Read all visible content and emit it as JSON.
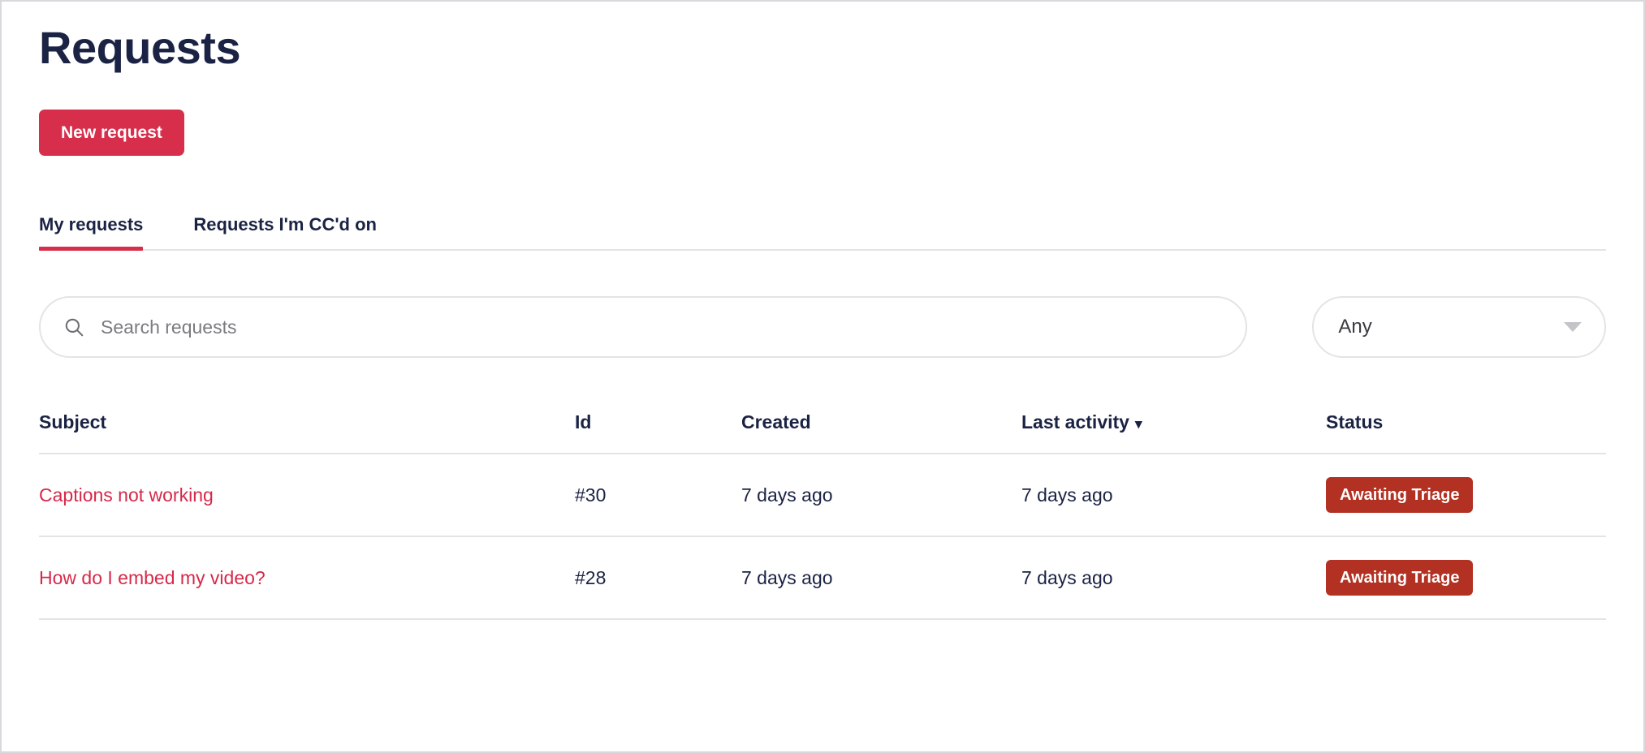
{
  "page": {
    "title": "Requests"
  },
  "actions": {
    "new_request_label": "New request"
  },
  "tabs": [
    {
      "label": "My requests",
      "active": true
    },
    {
      "label": "Requests I'm CC'd on",
      "active": false
    }
  ],
  "filters": {
    "search": {
      "placeholder": "Search requests",
      "value": "",
      "icon": "search-icon"
    },
    "status_select": {
      "selected": "Any",
      "icon": "chevron-down-icon"
    }
  },
  "table": {
    "columns": [
      {
        "key": "subject",
        "label": "Subject",
        "sorted": false
      },
      {
        "key": "id",
        "label": "Id",
        "sorted": false
      },
      {
        "key": "created",
        "label": "Created",
        "sorted": false
      },
      {
        "key": "last_activity",
        "label": "Last activity",
        "sorted": true,
        "sort_caret": "▾"
      },
      {
        "key": "status",
        "label": "Status",
        "sorted": false
      }
    ],
    "rows": [
      {
        "subject": "Captions not working",
        "id": "#30",
        "created": "7 days ago",
        "last_activity": "7 days ago",
        "status": "Awaiting Triage"
      },
      {
        "subject": "How do I embed my video?",
        "id": "#28",
        "created": "7 days ago",
        "last_activity": "7 days ago",
        "status": "Awaiting Triage"
      }
    ]
  },
  "colors": {
    "brand_red": "#d62e4b",
    "link_red": "#d6294a",
    "badge_red": "#b23122",
    "text_navy": "#1b2344",
    "border_gray": "#e4e4e7"
  }
}
